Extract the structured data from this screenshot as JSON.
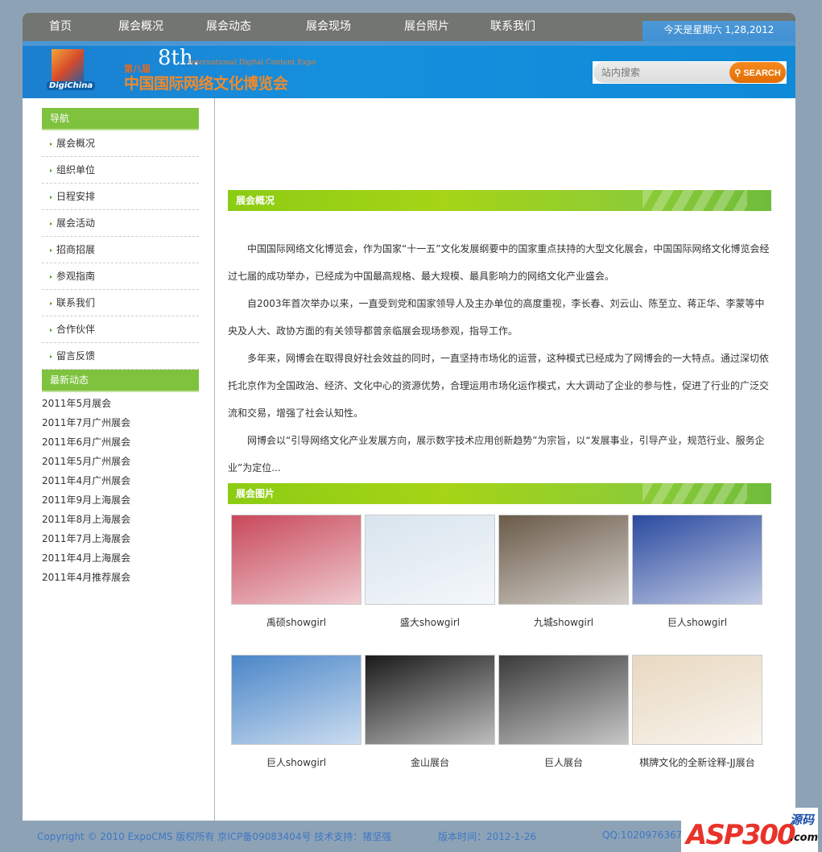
{
  "nav": {
    "items": [
      "首页",
      "展会概况",
      "展会动态",
      "展会现场",
      "展台照片",
      "联系我们"
    ],
    "date": "今天是星期六  1,28,2012"
  },
  "banner": {
    "logo": "DigiChina",
    "edition": "第八届",
    "eighth": "8th.",
    "english": "International Digital Content Expo",
    "title": "中国国际网络文化博览会"
  },
  "search": {
    "placeholder": "站内搜索",
    "button": "SEARCH"
  },
  "sidebar": {
    "nav_title": "导航",
    "items": [
      "展会概况",
      "组织单位",
      "日程安排",
      "展会活动",
      "招商招展",
      "参观指南",
      "联系我们",
      "合作伙伴",
      "留言反馈"
    ],
    "news_title": "最新动态",
    "news": [
      "2011年5月展会",
      "2011年7月广州展会",
      "2011年6月广州展会",
      "2011年5月广州展会",
      "2011年4月广州展会",
      "2011年9月上海展会",
      "2011年8月上海展会",
      "2011年7月上海展会",
      "2011年4月上海展会",
      "2011年4月推荐展会"
    ]
  },
  "main": {
    "overview_title": "展会概况",
    "paragraphs": [
      "中国国际网络文化博览会，作为国家“十一五”文化发展纲要中的国家重点扶持的大型文化展会，中国国际网络文化博览会经过七届的成功举办，已经成为中国最高规格、最大规模、最具影响力的网络文化产业盛会。",
      "自2003年首次举办以来，一直受到党和国家领导人及主办单位的高度重视，李长春、刘云山、陈至立、蒋正华、李蒙等中央及人大、政协方面的有关领导都曾亲临展会现场参观，指导工作。",
      "多年来，网博会在取得良好社会效益的同时，一直坚持市场化的运营，这种模式已经成为了网博会的一大特点。通过深切依托北京作为全国政治、经济、文化中心的资源优势，合理运用市场化运作模式，大大调动了企业的参与性，促进了行业的广泛交流和交易，增强了社会认知性。",
      "网博会以“引导网络文化产业发展方向，展示数字技术应用创新趋势”为宗旨，以“发展事业，引导产业，规范行业、服务企业”为定位..."
    ],
    "photos_title": "展会图片",
    "photos": [
      {
        "caption": "禹硕showgirl",
        "color": "#c8485a"
      },
      {
        "caption": "盛大showgirl",
        "color": "#d8e4ee"
      },
      {
        "caption": "九城showgirl",
        "color": "#6a5a48"
      },
      {
        "caption": "巨人showgirl",
        "color": "#2a4aa0"
      },
      {
        "caption": "巨人showgirl",
        "color": "#4a86c8"
      },
      {
        "caption": "金山展台",
        "color": "#1a1a1a"
      },
      {
        "caption": "巨人展台",
        "color": "#3a3a3a"
      },
      {
        "caption": "棋牌文化的全新诠释-JJ展台",
        "color": "#e8d8c0"
      }
    ]
  },
  "footer": {
    "copyright": "Copyright © 2010 ExpoCMS 版权所有  京ICP备09083404号  技术支持：猪坚强",
    "version": "版本时间：2012-1-26",
    "qq": "QQ:1020976367"
  },
  "watermark": {
    "brand": "ASP300",
    "suffix1": "源码",
    "suffix2": ".com"
  }
}
